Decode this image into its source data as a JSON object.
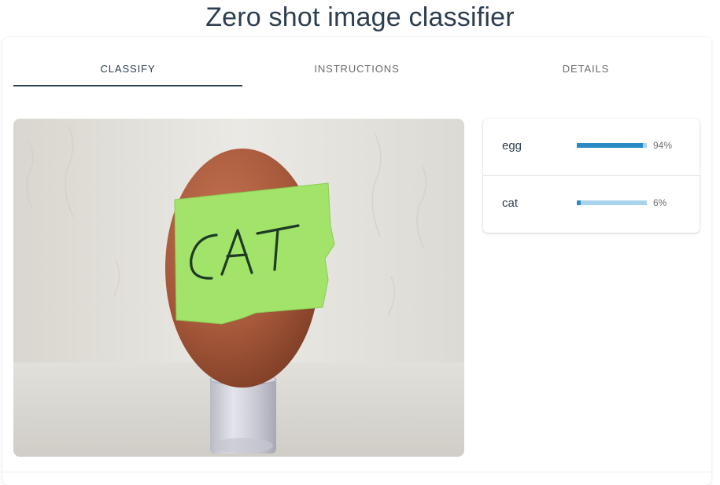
{
  "header": {
    "title": "Zero shot image classifier"
  },
  "tabs": [
    {
      "label": "CLASSIFY",
      "active": true
    },
    {
      "label": "INSTRUCTIONS",
      "active": false
    },
    {
      "label": "DETAILS",
      "active": false
    }
  ],
  "image": {
    "note_text": "CAT",
    "colors": {
      "egg": "#a6583a",
      "note": "#a2e36a",
      "wall": "#e6e4df"
    }
  },
  "results": [
    {
      "label": "egg",
      "percent": "94%",
      "value": 0.94
    },
    {
      "label": "cat",
      "percent": "6%",
      "value": 0.06
    }
  ],
  "colors": {
    "accent": "#2a8ac4",
    "track": "#a9d4ec",
    "title": "#2c3e50"
  }
}
